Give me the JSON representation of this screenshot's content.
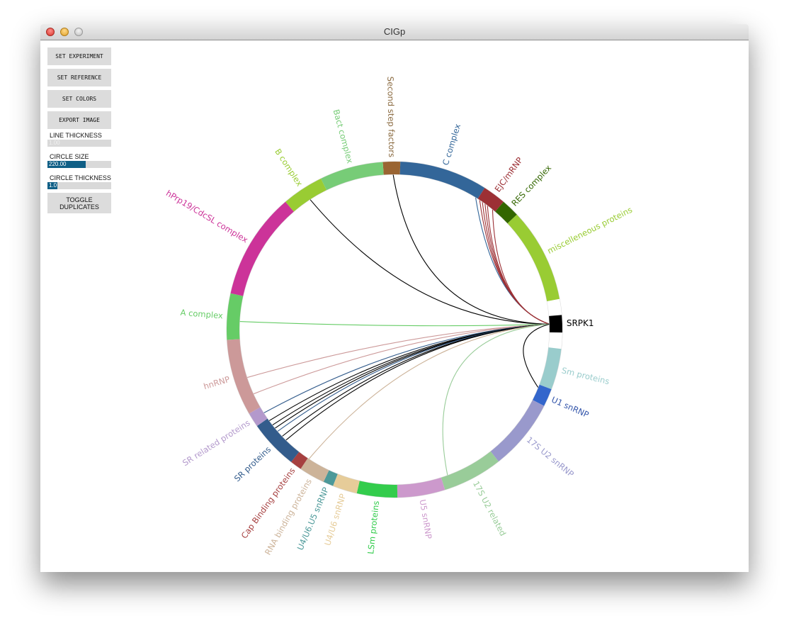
{
  "window": {
    "title": "CIGp"
  },
  "controls": {
    "buttons": [
      {
        "id": "set-experiment",
        "label": "SET EXPERIMENT"
      },
      {
        "id": "set-reference",
        "label": "SET REFERENCE"
      },
      {
        "id": "set-colors",
        "label": "SET COLORS"
      },
      {
        "id": "export-image",
        "label": "EXPORT IMAGE"
      }
    ],
    "line_thickness": {
      "label": "LINE THICKNESS",
      "value": "1.00",
      "fraction": 0.0
    },
    "circle_size": {
      "label": "CIRCLE SIZE",
      "value": "220.00",
      "fraction": 0.6
    },
    "circle_thickness": {
      "label": "CIRCLE THICKNESS",
      "value": "1.0",
      "fraction": 0.15
    },
    "toggle_duplicates": {
      "label": "TOGGLE\nDUPLICATES"
    }
  },
  "chart_data": {
    "type": "chord",
    "title": "",
    "hub": {
      "name": "SRPK1",
      "color": "#000000",
      "start_deg": 85,
      "end_deg": 91
    },
    "segments": [
      {
        "name": "Second step factors",
        "color": "#9a6432",
        "start_deg": -4,
        "end_deg": 2
      },
      {
        "name": "C complex",
        "color": "#336699",
        "start_deg": 2,
        "end_deg": 32.5
      },
      {
        "name": "EJC/mRNP",
        "color": "#9c3035",
        "start_deg": 32.5,
        "end_deg": 40.5
      },
      {
        "name": "RES complex",
        "color": "#336600",
        "start_deg": 40.5,
        "end_deg": 46.8
      },
      {
        "name": "miscelleneous proteins",
        "color": "#99cc33",
        "start_deg": 46.8,
        "end_deg": 79.5
      },
      {
        "name": "",
        "color": "#ffffff",
        "start_deg": 79.5,
        "end_deg": 85
      },
      {
        "name": "",
        "color": "#ffffff",
        "start_deg": 91,
        "end_deg": 96.6
      },
      {
        "name": "Sm proteins",
        "color": "#99cccc",
        "start_deg": 96.6,
        "end_deg": 110.8
      },
      {
        "name": "U1 snRNP",
        "color": "#3366cc",
        "start_deg": 110.8,
        "end_deg": 117
      },
      {
        "name": "17S U2 snRNP",
        "color": "#9999cc",
        "start_deg": 117,
        "end_deg": 141.7
      },
      {
        "name": "17S U2 related",
        "color": "#99cc99",
        "start_deg": 141.7,
        "end_deg": 162.5
      },
      {
        "name": "U5 snRNP",
        "color": "#cc99cc",
        "start_deg": 162.5,
        "end_deg": 179
      },
      {
        "name": "LSm proteins",
        "color": "#33cc4c",
        "start_deg": 179,
        "end_deg": 193
      },
      {
        "name": "U4/U6 snRNP",
        "color": "#e6cc99",
        "start_deg": 193,
        "end_deg": 201.5
      },
      {
        "name": "U4/U6.U5 snRNP",
        "color": "#4c9999",
        "start_deg": 201.5,
        "end_deg": 205
      },
      {
        "name": "RNA binding proteins",
        "color": "#ccb399",
        "start_deg": 205,
        "end_deg": 214
      },
      {
        "name": "Cap Binding proteins",
        "color": "#a64040",
        "start_deg": 214,
        "end_deg": 218
      },
      {
        "name": "SR proteins",
        "color": "#335c8c",
        "start_deg": 218,
        "end_deg": 235
      },
      {
        "name": "SR related proteins",
        "color": "#b399cc",
        "start_deg": 235,
        "end_deg": 240
      },
      {
        "name": "hnRNP",
        "color": "#cc9999",
        "start_deg": 240,
        "end_deg": 266.5
      },
      {
        "name": "A complex",
        "color": "#66cc66",
        "start_deg": 266.5,
        "end_deg": 282.5
      },
      {
        "name": "hPrp19/CdcSL complex",
        "color": "#cc3399",
        "start_deg": 282.5,
        "end_deg": 319.5
      },
      {
        "name": "B complex",
        "color": "#99cc33",
        "start_deg": 319.5,
        "end_deg": 334
      },
      {
        "name": "Bact complex",
        "color": "#77cc77",
        "start_deg": 334,
        "end_deg": 356
      }
    ],
    "label_colors": {
      "Second step factors": "#8a6a40",
      "C complex": "#336699",
      "EJC/mRNP": "#9c3035",
      "RES complex": "#336600",
      "miscelleneous proteins": "#99cc33",
      "Sm proteins": "#99cccc",
      "U1 snRNP": "#3355aa",
      "17S U2 snRNP": "#9999cc",
      "17S U2 related": "#99cc99",
      "U5 snRNP": "#cc99cc",
      "LSm proteins": "#33cc4c",
      "U4/U6 snRNP": "#e6cc99",
      "U4/U6.U5 snRNP": "#4c9999",
      "RNA binding proteins": "#ccb399",
      "Cap Binding proteins": "#a64040",
      "SR proteins": "#335c8c",
      "SR related proteins": "#b399cc",
      "hnRNP": "#cc9999",
      "A complex": "#66cc66",
      "hPrp19/CdcSL complex": "#cc3399",
      "B complex": "#99cc33",
      "Bact complex": "#77cc77"
    },
    "links": [
      {
        "target": "B complex",
        "target_deg": 327,
        "color": "#000000"
      },
      {
        "target": "Second step factors",
        "target_deg": -0.5,
        "color": "#000000"
      },
      {
        "target": "C complex",
        "target_deg": 31.5,
        "color": "#336699"
      },
      {
        "target": "EJC/mRNP",
        "target_deg": 33.3,
        "color": "#9c3035"
      },
      {
        "target": "EJC/mRNP",
        "target_deg": 34.5,
        "color": "#9c3035"
      },
      {
        "target": "EJC/mRNP",
        "target_deg": 35.7,
        "color": "#9c3035"
      },
      {
        "target": "EJC/mRNP",
        "target_deg": 36.8,
        "color": "#9c3035"
      },
      {
        "target": "EJC/mRNP",
        "target_deg": 39.2,
        "color": "#9c3035"
      },
      {
        "target": "A complex",
        "target_deg": 273,
        "color": "#66cc66"
      },
      {
        "target": "hnRNP",
        "target_deg": 252,
        "color": "#cc9999"
      },
      {
        "target": "hnRNP",
        "target_deg": 245.5,
        "color": "#cc9999"
      },
      {
        "target": "SR related proteins",
        "target_deg": 237.5,
        "color": "#335c8c"
      },
      {
        "target": "SR proteins",
        "target_deg": 234,
        "color": "#000000"
      },
      {
        "target": "SR proteins",
        "target_deg": 232,
        "color": "#000000"
      },
      {
        "target": "SR proteins",
        "target_deg": 230.5,
        "color": "#000000"
      },
      {
        "target": "SR proteins",
        "target_deg": 229,
        "color": "#335c8c"
      },
      {
        "target": "SR proteins",
        "target_deg": 226.5,
        "color": "#000000"
      },
      {
        "target": "SR proteins",
        "target_deg": 224.5,
        "color": "#000000"
      },
      {
        "target": "RNA binding proteins",
        "target_deg": 213.5,
        "color": "#ccb399"
      },
      {
        "target": "17S U2 related",
        "target_deg": 160,
        "color": "#99cc99"
      },
      {
        "target": "U1 snRNP",
        "target_deg": 112,
        "color": "#000000"
      }
    ]
  }
}
